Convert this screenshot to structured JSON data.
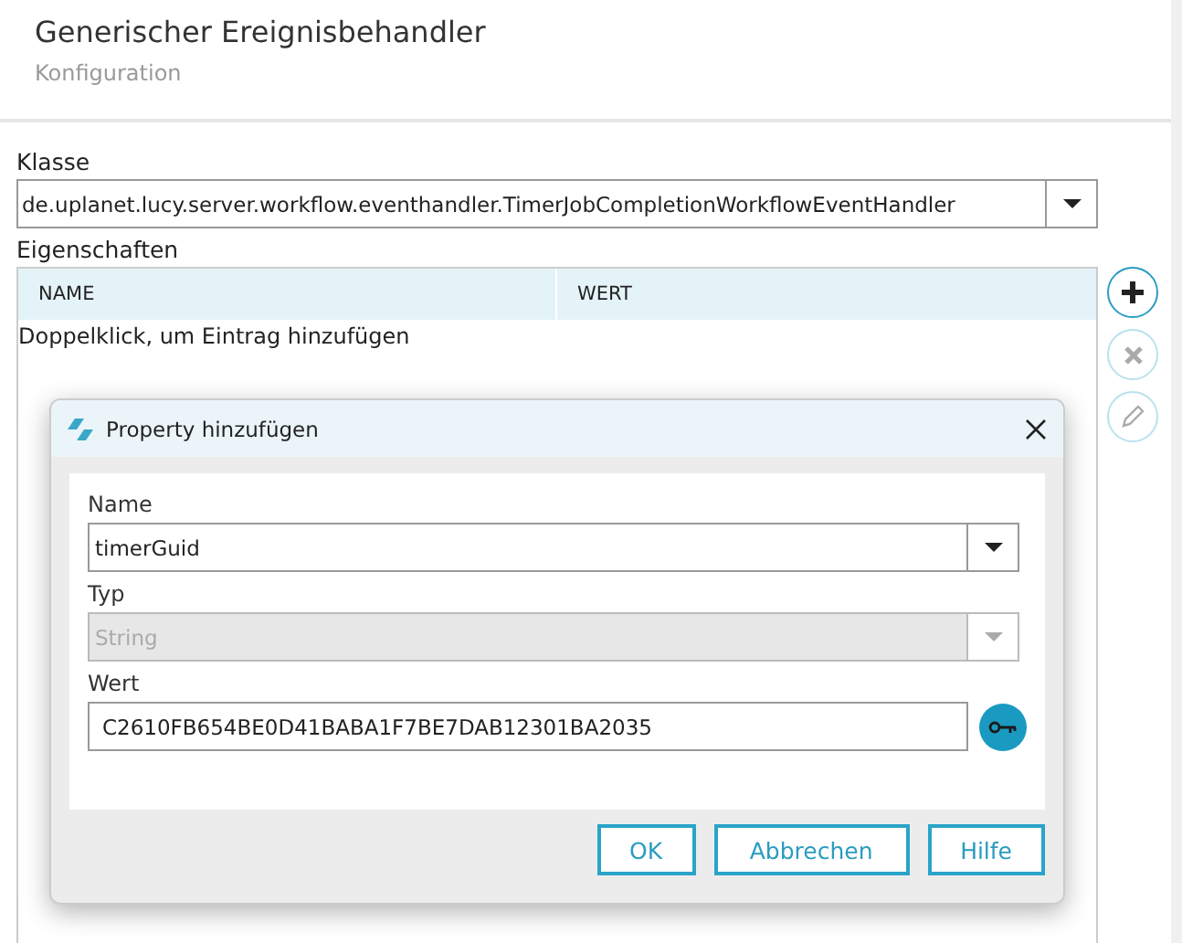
{
  "header": {
    "title": "Generischer Ereignisbehandler",
    "subtitle": "Konfiguration"
  },
  "class_field": {
    "label": "Klasse",
    "value": "de.uplanet.lucy.server.workflow.eventhandler.TimerJobCompletionWorkflowEventHandler"
  },
  "properties": {
    "label": "Eigenschaften",
    "columns": [
      "NAME",
      "WERT"
    ],
    "empty_hint": "Doppelklick, um Eintrag hinzufügen"
  },
  "side_buttons": [
    {
      "kind": "add",
      "disabled": false
    },
    {
      "kind": "delete",
      "disabled": true
    },
    {
      "kind": "edit",
      "disabled": true
    }
  ],
  "dialog": {
    "title": "Property hinzufügen",
    "fields": [
      {
        "label": "Name",
        "kind": "combo",
        "value": "timerGuid",
        "disabled": false
      },
      {
        "label": "Typ",
        "kind": "combo",
        "value": "String",
        "disabled": true
      },
      {
        "label": "Wert",
        "kind": "secret",
        "value": "C2610FB654BE0D41BABA1F7BE7DAB12301BA2035",
        "disabled": false
      }
    ],
    "buttons": [
      "OK",
      "Abbrechen",
      "Hilfe"
    ]
  }
}
